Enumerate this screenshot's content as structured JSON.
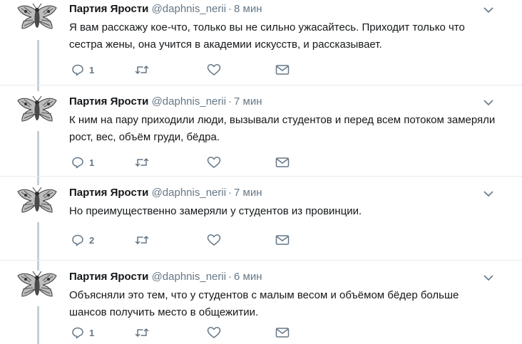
{
  "tweets": [
    {
      "name": "Партия Ярости",
      "handle": "@daphnis_nerii",
      "time": "8 мин",
      "text": "Я вам расскажу кое-что, только вы не сильно ужасайтесь. Приходит только что сестра жены, она учится в академии искусств, и рассказывает.",
      "replies": "1"
    },
    {
      "name": "Партия Ярости",
      "handle": "@daphnis_nerii",
      "time": "7 мин",
      "text": "К ним на пару приходили люди, вызывали студентов и перед всем потоком замеряли рост, вес, объём груди, бёдра.",
      "replies": "1"
    },
    {
      "name": "Партия Ярости",
      "handle": "@daphnis_nerii",
      "time": "7 мин",
      "text": "Но преимущественно замеряли у студентов из провинции.",
      "replies": "2"
    },
    {
      "name": "Партия Ярости",
      "handle": "@daphnis_nerii",
      "time": "6 мин",
      "text": "Объясняли это тем, что у студентов с малым весом и объёмом бёдер больше шансов получить место в общежитии.",
      "replies": "1"
    }
  ],
  "separator": "·",
  "icons": [
    "moth-avatar-icon",
    "chevron-down-icon",
    "reply-icon",
    "retweet-icon",
    "heart-icon",
    "envelope-icon"
  ],
  "colors": {
    "text": "#14171a",
    "secondary": "#657786",
    "thread_line": "#c4cfd6",
    "divider": "#e6ecf0"
  }
}
